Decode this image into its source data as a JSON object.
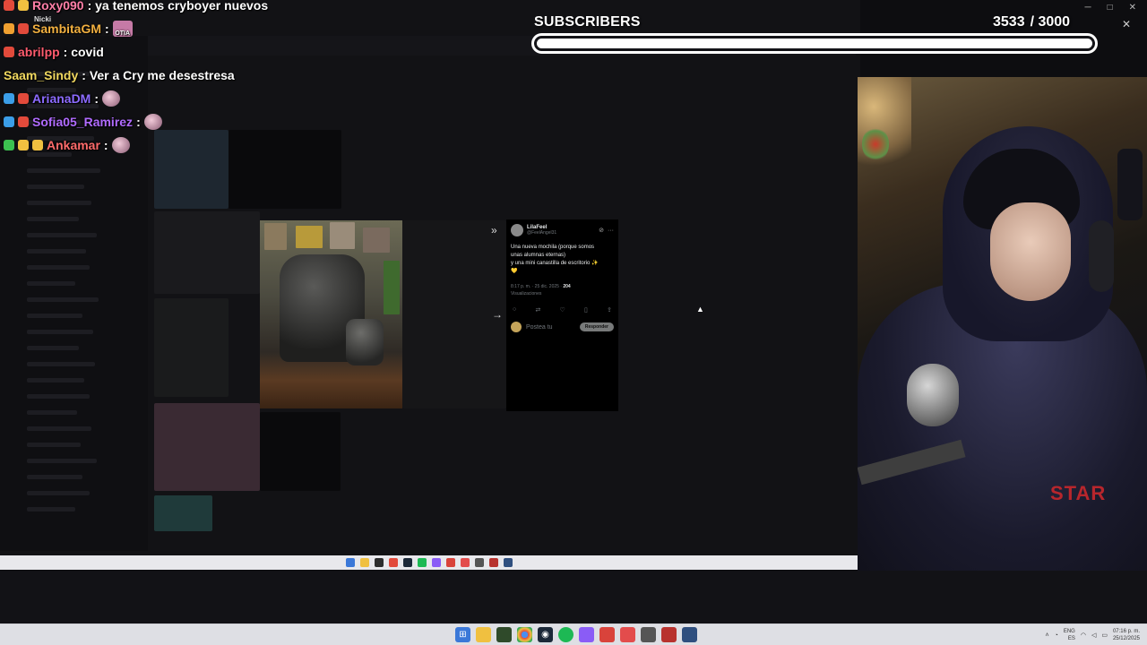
{
  "chat": {
    "messages": [
      {
        "user": "Roxy090",
        "user_color": "#ff7fa8",
        "text": ": ya tenemos cryboyer nuevos",
        "emote": ""
      },
      {
        "user": "SambitaGM",
        "user_color": "#f2b040",
        "text": ":",
        "emote": "OTIA"
      },
      {
        "user": "abrilpp",
        "user_color": "#ff5b6e",
        "text": ": covid",
        "emote": ""
      },
      {
        "user": "Saam_Sindy",
        "user_color": "#f0d860",
        "text": ": Ver a Cry me desestresa",
        "emote": ""
      },
      {
        "user": "ArianaDM",
        "user_color": "#8c6bff",
        "text": ":",
        "emote": "emote"
      },
      {
        "user": "Sofia05_Ramirez",
        "user_color": "#b06bff",
        "text": ":",
        "emote": "emote"
      },
      {
        "user": "Ankamar",
        "user_color": "#ff6b6b",
        "text": ":",
        "emote": "emote"
      }
    ],
    "overlay_tag": "Nicki"
  },
  "subscribers": {
    "title": "SUBSCRIBERS",
    "current": "3533",
    "goal": "/ 3000",
    "progress_fraction": 1.0
  },
  "tweet": {
    "name": "LilaFeel",
    "handle": "@FeelAngel31",
    "text_line1": "Una nueva mochila (porque somos",
    "text_line2": "unas alumnas eternas)",
    "text_line3": "y una mini canastilla de escritorio ✨",
    "emoji": "💛",
    "meta_time": "8:17 p. m. · 25 dic. 2025 ·",
    "meta_views_count": "204",
    "meta_views_label": "Visualizaciones",
    "reply_placeholder": "Postea tu",
    "reply_button": "Responder"
  },
  "webcam": {
    "hoodie_print": "STAR"
  },
  "taskbar": {
    "lang": "ENG",
    "lang_sub": "ES",
    "time": "07:16 p. m.",
    "date": "25/12/2025"
  },
  "colors": {
    "subs_fill": "#ffffff",
    "taskbar_bg": "#dedfe4",
    "tweet_bg": "#000000"
  }
}
